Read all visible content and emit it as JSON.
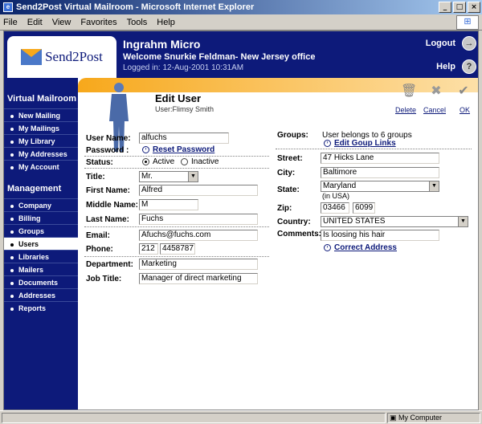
{
  "window": {
    "title": "Send2Post Virtual Mailroom - Microsoft Internet Explorer",
    "app_icon": "e",
    "btn_min": "_",
    "btn_max": "□",
    "btn_close": "×"
  },
  "menu": {
    "items": [
      "File",
      "Edit",
      "View",
      "Favorites",
      "Tools",
      "Help"
    ]
  },
  "header": {
    "logo_text": "Send2Post",
    "company": "Ingrahm Micro",
    "welcome": "Welcome Snurkie Feldman- New Jersey office",
    "logged_in": "Logged in: 12-Aug-2001 10:31AM",
    "logout": "Logout",
    "help": "Help",
    "logout_icon": "→",
    "help_icon": "?"
  },
  "sidebar": {
    "section1": "Virtual Mailroom",
    "items1": [
      "New Mailing",
      "My Mailings",
      "My Library",
      "My Addresses",
      "My Account"
    ],
    "section2": "Management",
    "items2": [
      "Company",
      "Billing",
      "Groups",
      "Users",
      "Libraries",
      "Mailers",
      "Documents",
      "Addresses",
      "Reports"
    ],
    "active": "Users"
  },
  "page": {
    "title": "Edit User",
    "subtitle": "User:Flimsy Smith",
    "delete": "Delete",
    "cancel": "Cancel",
    "ok": "OK",
    "delete_icon": "🗑",
    "cancel_icon": "✖",
    "ok_icon": "✔"
  },
  "form": {
    "username_label": "User Name:",
    "username": "alfuchs",
    "password_label": "Password :",
    "reset_password": "Reset Password",
    "status_label": "Status:",
    "status_active": "Active",
    "status_inactive": "Inactive",
    "status_value": "Active",
    "title_label": "Title:",
    "title": "Mr.",
    "first_label": "First Name:",
    "first": "Alfred",
    "middle_label": "Middle Name:",
    "middle": "M",
    "last_label": "Last Name:",
    "last": "Fuchs",
    "email_label": "Email:",
    "email": "Afuchs@fuchs.com",
    "phone_label": "Phone:",
    "phone_area": "212",
    "phone_number": "4458787",
    "department_label": "Department:",
    "department": "Marketing",
    "jobtitle_label": "Job Title:",
    "jobtitle": "Manager of direct marketing",
    "groups_label": "Groups:",
    "groups_text": "User belongs to 6 groups",
    "edit_groups": "Edit Goup Links",
    "street_label": "Street:",
    "street": "47 Hicks Lane",
    "city_label": "City:",
    "city": "Baltimore",
    "state_label": "State:",
    "state": "Maryland",
    "state_note": "(in USA)",
    "zip_label": "Zip:",
    "zip1": "03466",
    "zip2": "6099",
    "country_label": "Country:",
    "country": "UNITED STATES",
    "comments_label": "Comments:",
    "comments": "Is loosing his hair",
    "correct_address": "Correct Address",
    "link_icon": "›"
  },
  "statusbar": {
    "zone": "My Computer"
  }
}
